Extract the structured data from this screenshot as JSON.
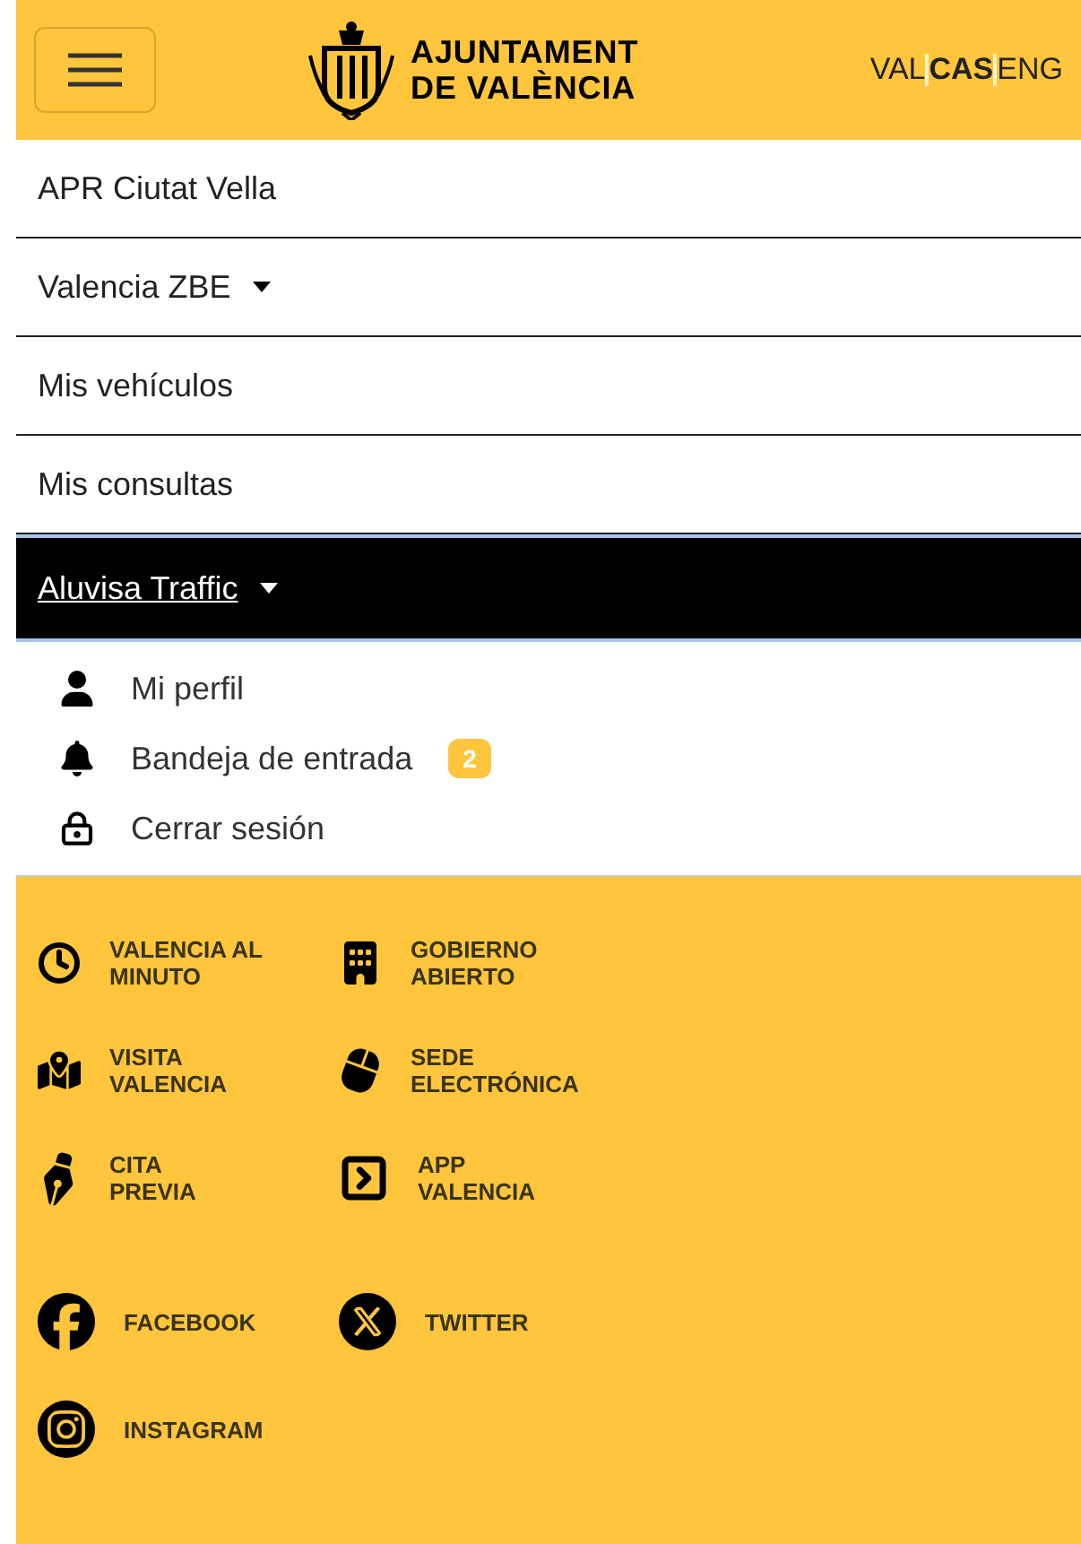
{
  "header": {
    "logo_lines": [
      "AJUNTAMENT",
      "DE VALÈNCIA"
    ],
    "languages": [
      {
        "label": "VAL",
        "selected": false
      },
      {
        "label": "CAS",
        "selected": true
      },
      {
        "label": "ENG",
        "selected": false
      }
    ]
  },
  "nav": [
    {
      "label": "APR Ciutat Vella",
      "kind": "link",
      "active": false
    },
    {
      "label": "Valencia ZBE",
      "kind": "dropdown",
      "active": false
    },
    {
      "label": "Mis vehículos",
      "kind": "link",
      "active": false
    },
    {
      "label": "Mis consultas",
      "kind": "link",
      "active": false
    },
    {
      "label": "Aluvisa Traffic",
      "kind": "dropdown",
      "active": true,
      "children": [
        {
          "label": "Mi perfil"
        },
        {
          "label": "Bandeja de entrada",
          "badge": "2"
        },
        {
          "label": "Cerrar sesión"
        }
      ]
    }
  ],
  "footer_links": [
    {
      "lines": [
        "VALENCIA AL",
        "MINUTO"
      ]
    },
    {
      "lines": [
        "GOBIERNO",
        "ABIERTO"
      ]
    },
    {
      "lines": [
        "VISITA",
        "VALENCIA"
      ]
    },
    {
      "lines": [
        "SEDE",
        "ELECTRÓNICA"
      ]
    },
    {
      "lines": [
        "CITA",
        "PREVIA"
      ]
    },
    {
      "lines": [
        "APP",
        "VALENCIA"
      ]
    },
    {
      "lines": [
        "FACEBOOK"
      ]
    },
    {
      "lines": [
        "TWITTER"
      ]
    },
    {
      "lines": [
        "INSTAGRAM"
      ]
    }
  ]
}
